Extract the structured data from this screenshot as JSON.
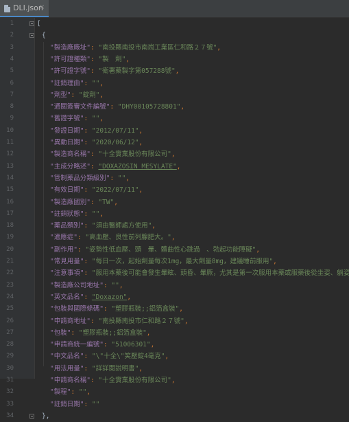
{
  "tab": {
    "filename": "DLI.json",
    "close_icon": "×"
  },
  "lines": [
    {
      "n": "1",
      "type": "open",
      "text": "["
    },
    {
      "n": "2",
      "type": "open",
      "text": "{"
    },
    {
      "n": "3",
      "type": "kv",
      "key": "\"製造廠廠址\"",
      "val": "\"南投縣南投市南崗工業區仁和路２７號\""
    },
    {
      "n": "4",
      "type": "kv",
      "key": "\"許可證種類\"",
      "val": "\"製　劑\""
    },
    {
      "n": "5",
      "type": "kv",
      "key": "\"許可證字號\"",
      "val": "\"衛署藥製字第057288號\""
    },
    {
      "n": "6",
      "type": "kv",
      "key": "\"註銷理由\"",
      "val": "\"\""
    },
    {
      "n": "7",
      "type": "kv",
      "key": "\"劑型\"",
      "val": "\"錠劑\""
    },
    {
      "n": "8",
      "type": "kv",
      "key": "\"通關簽審文件編號\"",
      "val": "\"DHY00105728801\""
    },
    {
      "n": "9",
      "type": "kv",
      "key": "\"舊證字號\"",
      "val": "\"\""
    },
    {
      "n": "10",
      "type": "kv",
      "key": "\"發證日期\"",
      "val": "\"2012/07/11\""
    },
    {
      "n": "11",
      "type": "kv",
      "key": "\"異動日期\"",
      "val": "\"2020/06/12\""
    },
    {
      "n": "12",
      "type": "kv",
      "key": "\"製造商名稱\"",
      "val": "\"十全實業股份有限公司\""
    },
    {
      "n": "13",
      "type": "kv",
      "key": "\"主成分略述\"",
      "val": "\"DOXAZOSIN MESYLATE\"",
      "underline": true
    },
    {
      "n": "14",
      "type": "kv",
      "key": "\"管制藥品分類級別\"",
      "val": "\"\""
    },
    {
      "n": "15",
      "type": "kv",
      "key": "\"有效日期\"",
      "val": "\"2022/07/11\""
    },
    {
      "n": "16",
      "type": "kv",
      "key": "\"製造廠國別\"",
      "val": "\"TW\""
    },
    {
      "n": "17",
      "type": "kv",
      "key": "\"註銷狀態\"",
      "val": "\"\""
    },
    {
      "n": "18",
      "type": "kv",
      "key": "\"藥品類別\"",
      "val": "\"須由醫師處方使用\""
    },
    {
      "n": "19",
      "type": "kv",
      "key": "\"適應症\"",
      "val": "\"高血壓、良性前列腺肥大。\""
    },
    {
      "n": "20",
      "type": "kv",
      "key": "\"副作用\"",
      "val": "\"姿勢性低血壓、頭　暈、體曲性心跳過　、勃起功能障礙\""
    },
    {
      "n": "21",
      "type": "kv",
      "key": "\"常見用量\"",
      "val": "\"每日一次，起始劑量每次1mg，最大劑量8mg，建議睡前服用\""
    },
    {
      "n": "22",
      "type": "kv",
      "key": "\"注意事項\"",
      "val": "\"服用本藥後可能會發生暈眩、頭昏、暈厥，尤其是第一次服用本藥或服藥後從坐姿、躺姿　站",
      "nocomma": true
    },
    {
      "n": "23",
      "type": "kv",
      "key": "\"製造廠公司地址\"",
      "val": "\"\""
    },
    {
      "n": "24",
      "type": "kv",
      "key": "\"英文品名\"",
      "val": "\"Doxazon\"",
      "underline": true
    },
    {
      "n": "25",
      "type": "kv",
      "key": "\"包裝與國際條碼\"",
      "val": "\"塑膠瓶裝;;鋁箔盒裝\""
    },
    {
      "n": "26",
      "type": "kv",
      "key": "\"申請商地址\"",
      "val": "\"南投縣南投市仁和路２７號\""
    },
    {
      "n": "27",
      "type": "kv",
      "key": "\"包裝\"",
      "val": "\"塑膠瓶裝;;鋁箔盒裝\""
    },
    {
      "n": "28",
      "type": "kv",
      "key": "\"申請商統一編號\"",
      "val": "\"51006301\""
    },
    {
      "n": "29",
      "type": "kv",
      "key": "\"中文品名\"",
      "val": "\"\\\"十全\\\"笑壓錠4毫克\""
    },
    {
      "n": "30",
      "type": "kv",
      "key": "\"用法用量\"",
      "val": "\"詳詳閱說明書\""
    },
    {
      "n": "31",
      "type": "kv",
      "key": "\"申請商名稱\"",
      "val": "\"十全實業股份有限公司\""
    },
    {
      "n": "32",
      "type": "kv",
      "key": "\"製程\"",
      "val": "\"\""
    },
    {
      "n": "33",
      "type": "kv",
      "key": "\"註銷日期\"",
      "val": "\"\"",
      "nocomma": true
    },
    {
      "n": "34",
      "type": "close",
      "text": "},"
    }
  ]
}
